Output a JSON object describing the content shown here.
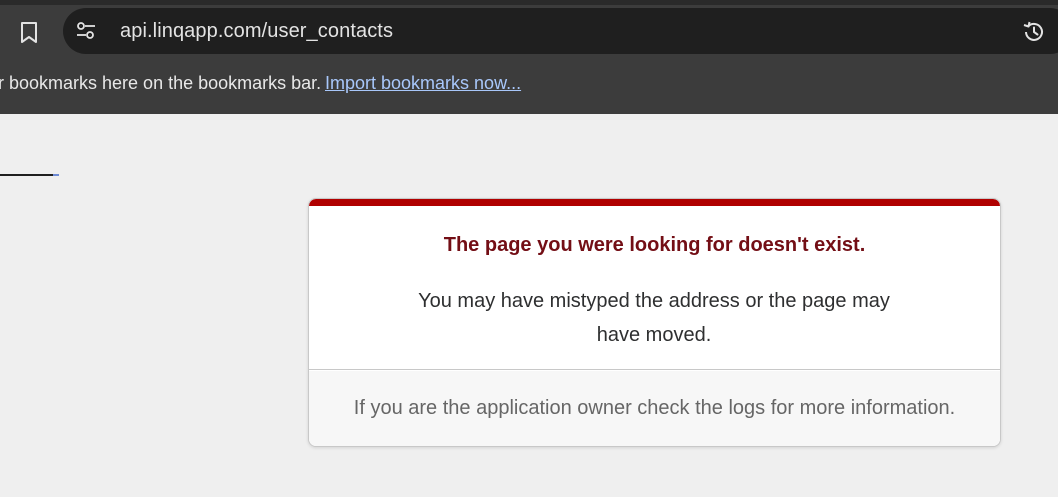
{
  "browser": {
    "url": "api.linqapp.com/user_contacts",
    "icons": [
      "bookmark-icon",
      "tune-icon",
      "history-icon"
    ]
  },
  "bookmarks_bar": {
    "message": "r bookmarks here on the bookmarks bar.",
    "import_link": "Import bookmarks now..."
  },
  "error_card": {
    "title": "The page you were looking for doesn't exist.",
    "message": "You may have mistyped the address or the page may have moved.",
    "footer_note": "If you are the application owner check the logs for more information.",
    "accent_color": "#b00000",
    "title_color": "#730e15"
  }
}
